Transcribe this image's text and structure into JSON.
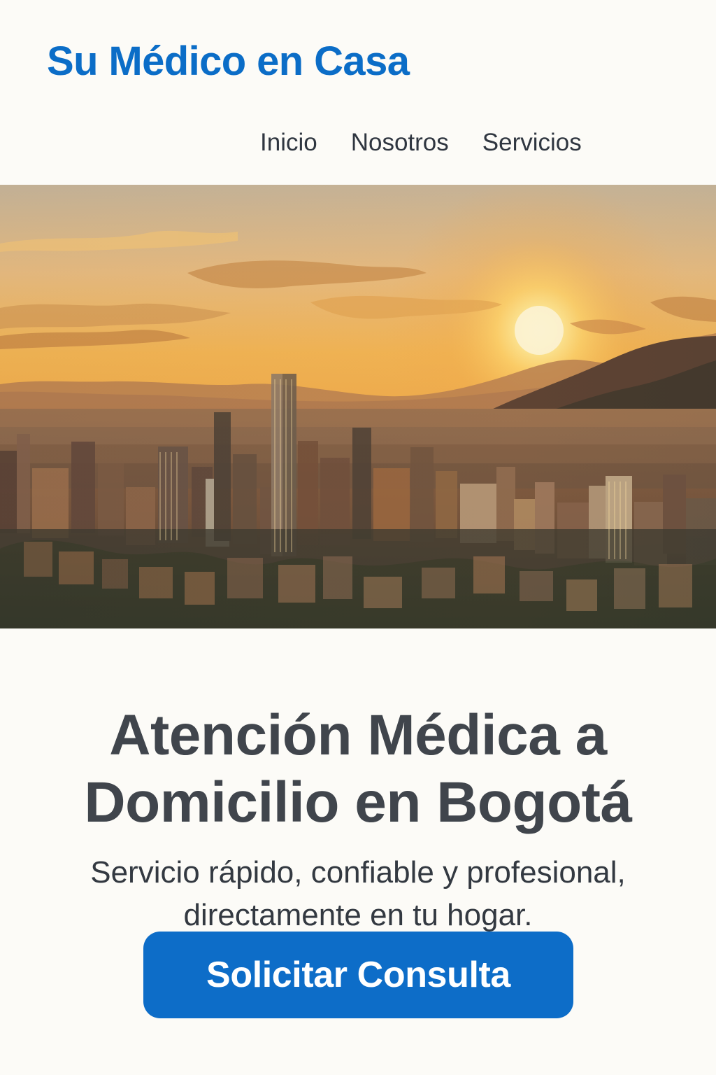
{
  "header": {
    "brand": "Su Médico en Casa",
    "nav": [
      {
        "label": "Inicio"
      },
      {
        "label": "Nosotros"
      },
      {
        "label": "Servicios"
      }
    ]
  },
  "hero": {
    "icon": "city-sunset-image"
  },
  "main": {
    "headline_line1": "Atención Médica a",
    "headline_line2": "Domicilio en Bogotá",
    "subhead_line1": "Servicio rápido, confiable y profesional,",
    "subhead_line2": "directamente en tu hogar.",
    "cta_label": "Solicitar Consulta"
  },
  "colors": {
    "brand": "#0b6dc7",
    "button": "#0d6dc8",
    "background": "#fcfbf7",
    "text": "#40454c"
  }
}
